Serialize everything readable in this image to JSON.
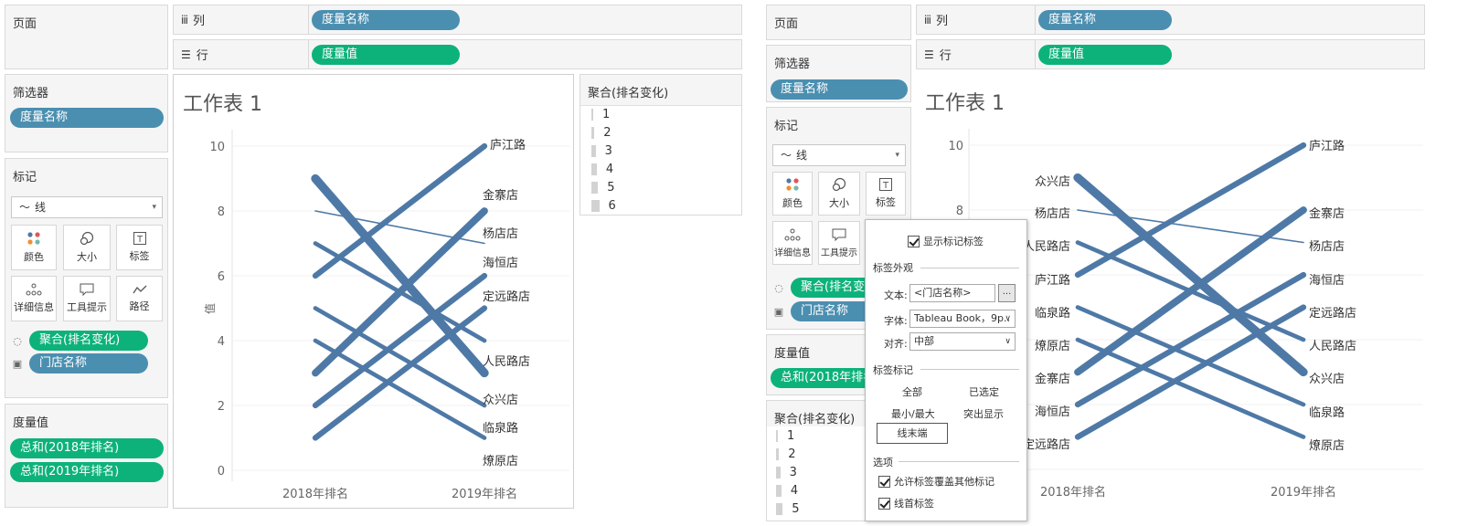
{
  "left": {
    "pages_title": "页面",
    "columns": {
      "label": "列",
      "pill": "度量名称"
    },
    "rows": {
      "label": "行",
      "pill": "度量值"
    },
    "filters": {
      "title": "筛选器",
      "pill": "度量名称"
    },
    "marks": {
      "title": "标记",
      "type": "线",
      "buttons": [
        "颜色",
        "大小",
        "标签",
        "详细信息",
        "工具提示",
        "路径"
      ],
      "fields": [
        {
          "icon": "size-icon",
          "label": "聚合(排名变化)"
        },
        {
          "icon": "label-icon",
          "label": "门店名称"
        }
      ]
    },
    "measure_values": {
      "title": "度量值",
      "pills": [
        "总和(2018年排名)",
        "总和(2019年排名)"
      ]
    },
    "sheet_title": "工作表 1",
    "legend": {
      "title": "聚合(排名变化)",
      "items": [
        "1",
        "2",
        "3",
        "4",
        "5",
        "6"
      ]
    }
  },
  "right": {
    "pages_title": "页面",
    "columns": {
      "label": "列",
      "pill": "度量名称"
    },
    "rows": {
      "label": "行",
      "pill": "度量值"
    },
    "filters": {
      "title": "筛选器",
      "pill": "度量名称"
    },
    "marks": {
      "title": "标记",
      "type": "线",
      "buttons": [
        "颜色",
        "大小",
        "标签",
        "详细信息",
        "工具提示"
      ],
      "fields": [
        {
          "icon": "size-icon",
          "label": "聚合(排名变"
        },
        {
          "icon": "label-icon",
          "label": "门店名称"
        }
      ]
    },
    "measure_values": {
      "title": "度量值",
      "pills": [
        "总和(2018年排名"
      ]
    },
    "legend": {
      "title": "聚合(排名变化)",
      "items": [
        "1",
        "2",
        "3",
        "4",
        "5"
      ]
    },
    "sheet_title": "工作表 1",
    "label_popup": {
      "show_labels": "显示标记标签",
      "appearance_title": "标签外观",
      "text_label": "文本:",
      "text_value": "<门店名称>",
      "text_button": "...",
      "font_label": "字体:",
      "font_value": "Tableau Book，9p..",
      "align_label": "对齐:",
      "align_value": "中部",
      "mark_label_title": "标签标记",
      "opt_all": "全部",
      "opt_selected": "已选定",
      "opt_minmax": "最小/最大",
      "opt_highlight": "突出显示",
      "opt_line_end": "线末端",
      "options_title": "选项",
      "opt_overlap": "允许标签覆盖其他标记",
      "opt_line_start": "线首标签"
    }
  },
  "chart_data": [
    {
      "type": "line",
      "title": "工作表 1",
      "ylabel": "值",
      "categories": [
        "2018年排名",
        "2019年排名"
      ],
      "ylim": [
        0,
        10
      ],
      "yticks": [
        0,
        2,
        4,
        6,
        8,
        10
      ],
      "line_color": "#4e79a7",
      "series": [
        {
          "name": "众兴店",
          "values": [
            9,
            3
          ],
          "rank_change": 6
        },
        {
          "name": "杨店店",
          "values": [
            8,
            7
          ],
          "rank_change": 1
        },
        {
          "name": "人民路店",
          "values": [
            7,
            4
          ],
          "rank_change": 3
        },
        {
          "name": "庐江路",
          "values": [
            6,
            10
          ],
          "rank_change": 4
        },
        {
          "name": "临泉路",
          "values": [
            5,
            2
          ],
          "rank_change": 3
        },
        {
          "name": "燎原店",
          "values": [
            4,
            1
          ],
          "rank_change": 3
        },
        {
          "name": "金寨店",
          "values": [
            3,
            8
          ],
          "rank_change": 5
        },
        {
          "name": "海恒店",
          "values": [
            2,
            6
          ],
          "rank_change": 4
        },
        {
          "name": "定远路店",
          "values": [
            1,
            5
          ],
          "rank_change": 4
        }
      ],
      "end_labels": [
        "庐江路",
        "金寨店",
        "杨店店",
        "海恒店",
        "定远路店",
        "人民路店",
        "众兴店",
        "临泉路",
        "燎原店"
      ]
    },
    {
      "type": "line",
      "title": "工作表 1",
      "categories": [
        "2018年排名",
        "2019年排名"
      ],
      "ylim": [
        0,
        10
      ],
      "yticks": [
        8,
        10
      ],
      "line_color": "#4e79a7",
      "series": [
        {
          "name": "众兴店",
          "values": [
            9,
            3
          ],
          "rank_change": 6
        },
        {
          "name": "杨店店",
          "values": [
            8,
            7
          ],
          "rank_change": 1
        },
        {
          "name": "人民路店",
          "values": [
            7,
            4
          ],
          "rank_change": 3
        },
        {
          "name": "庐江路",
          "values": [
            6,
            10
          ],
          "rank_change": 4
        },
        {
          "name": "临泉路",
          "values": [
            5,
            2
          ],
          "rank_change": 3
        },
        {
          "name": "燎原店",
          "values": [
            4,
            1
          ],
          "rank_change": 3
        },
        {
          "name": "金寨店",
          "values": [
            3,
            8
          ],
          "rank_change": 5
        },
        {
          "name": "海恒店",
          "values": [
            2,
            6
          ],
          "rank_change": 4
        },
        {
          "name": "定远路店",
          "values": [
            1,
            5
          ],
          "rank_change": 4
        }
      ],
      "start_labels": [
        "众兴店",
        "杨店店",
        "人民路店",
        "庐江路",
        "临泉路",
        "燎原店",
        "金寨店",
        "海恒店",
        "定远路店"
      ],
      "end_labels": [
        "庐江路",
        "金寨店",
        "杨店店",
        "海恒店",
        "定远路店",
        "人民路店",
        "众兴店",
        "临泉路",
        "燎原店"
      ]
    }
  ]
}
